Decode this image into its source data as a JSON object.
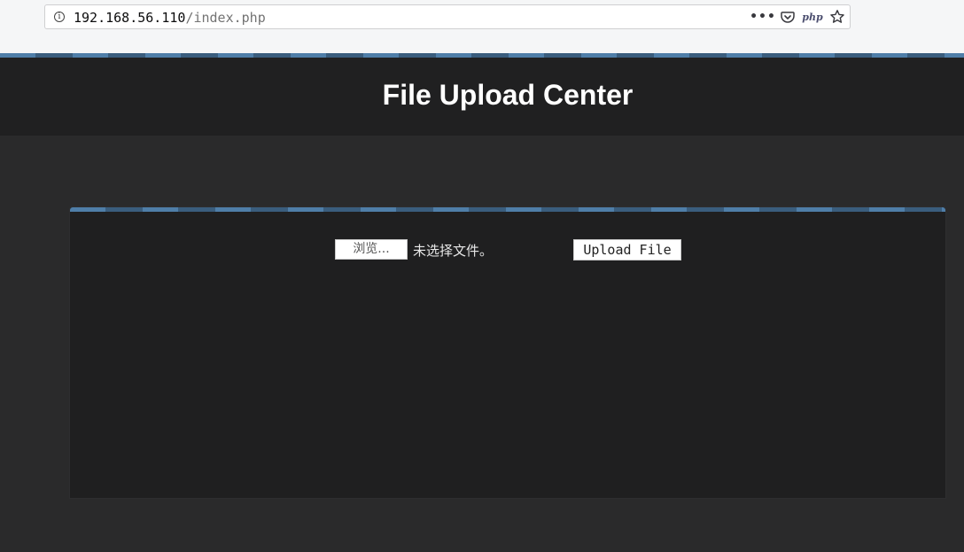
{
  "browser": {
    "url_host": "192.168.56.110",
    "url_path": "/index.php",
    "actions": {
      "more_icon": "more-dots-icon",
      "pocket_icon": "pocket-icon",
      "php_label": "php",
      "bookmark_icon": "star-icon"
    }
  },
  "header": {
    "title": "File Upload Center"
  },
  "form": {
    "browse_label": "浏览...",
    "file_status": "未选择文件。",
    "upload_label": "Upload File"
  },
  "colors": {
    "page_background": "#2a2a2b",
    "header_background": "#202021",
    "panel_background": "#1f1f20",
    "stripe_light": "#4f7ea8",
    "stripe_dark": "#3a5d7d"
  }
}
